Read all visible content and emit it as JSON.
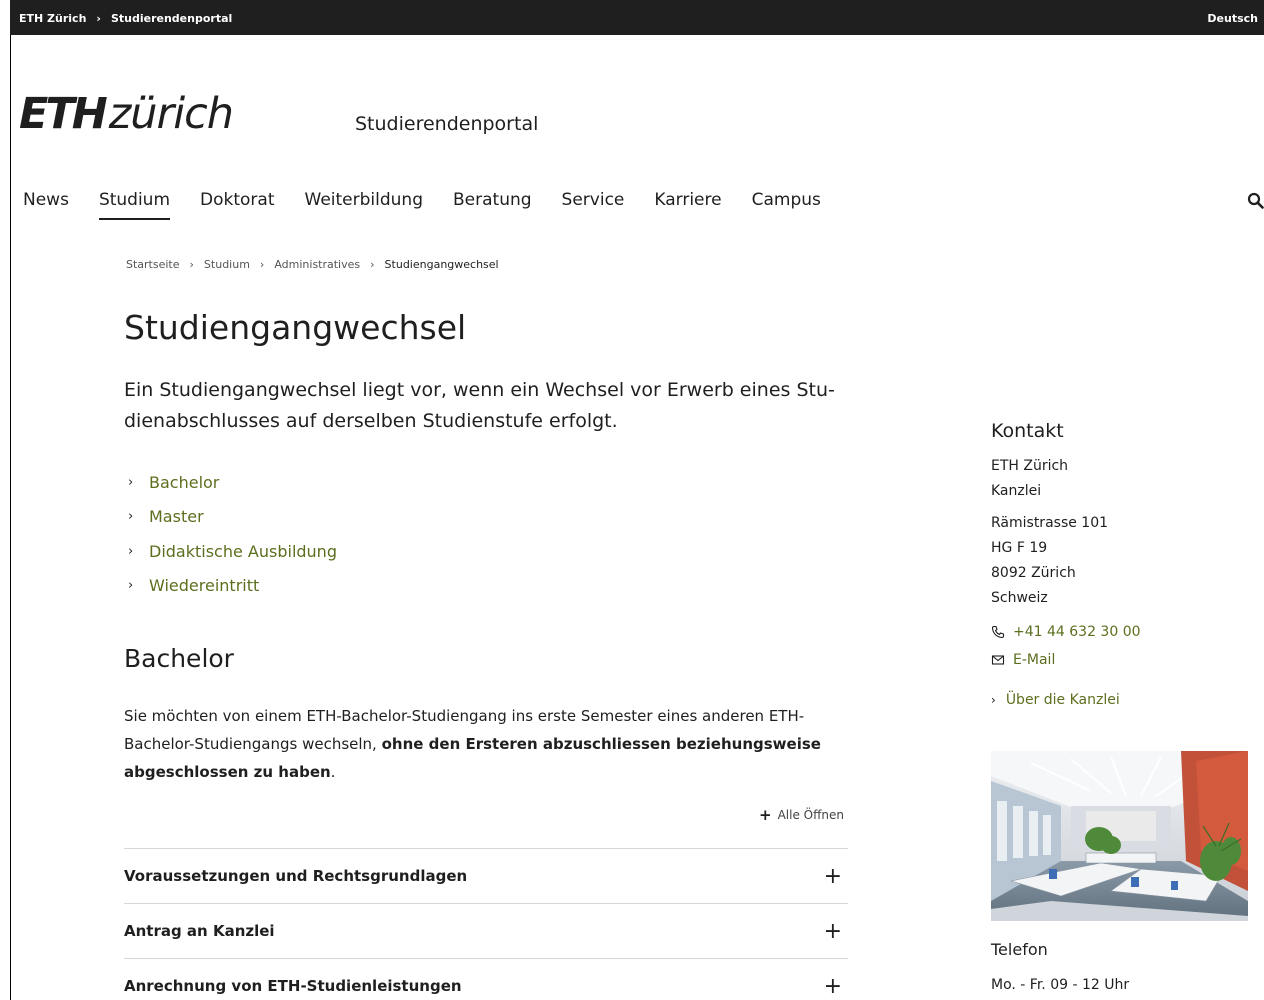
{
  "topbar": {
    "crumbs": [
      "ETH Zürich",
      "Studierendenportal"
    ],
    "sep": "›",
    "language": "Deutsch"
  },
  "logo": {
    "eth": "ETH",
    "zurich": "zürich"
  },
  "portal_title": "Studierendenportal",
  "nav": {
    "items": [
      "News",
      "Studium",
      "Doktorat",
      "Weiterbildung",
      "Beratung",
      "Service",
      "Karriere",
      "Campus"
    ],
    "active": "Studium",
    "search_icon": "search-icon"
  },
  "breadcrumb": {
    "items": [
      "Startseite",
      "Studium",
      "Administratives",
      "Studiengangwechsel"
    ],
    "sep": "›"
  },
  "main": {
    "title": "Studiengangwechsel",
    "lead": "Ein Studiengangwechsel liegt vor, wenn ein Wechsel vor Erwerb eines Stu-dienabschlusses auf derselben Studienstufe erfolgt.",
    "lead_line1": "Ein Studiengangwechsel liegt vor, wenn ein Wechsel vor Erwerb eines Stu-",
    "lead_line2": "dienabschlusses auf derselben Studienstufe erfolgt.",
    "anchors": [
      "Bachelor",
      "Master",
      "Didaktische Ausbildung",
      "Wiedereintritt"
    ],
    "chevron": "›",
    "section_heading": "Bachelor",
    "section_text_1": "Sie möchten von einem ETH-Bachelor-Studiengang ins erste Semester eines anderen ETH-Bachelor-Studiengangs wechseln, ",
    "section_text_bold": "ohne den Ersteren abzuschliessen beziehungsweise abgeschlossen zu haben",
    "section_text_end": ".",
    "open_all": "Alle Öffnen",
    "open_all_symbol": "+",
    "accordion": [
      "Voraussetzungen und Rechtsgrundlagen",
      "Antrag an Kanzlei",
      "Anrechnung von ETH-Studienleistungen"
    ],
    "accordion_symbol": "+"
  },
  "sidebar": {
    "heading": "Kontakt",
    "org_line1": "ETH Zürich",
    "org_line2": "Kanzlei",
    "address": [
      "Rämistrasse 101",
      "HG F 19",
      "8092 Zürich",
      "Schweiz"
    ],
    "phone": "+41 44 632 30 00",
    "email": "E-Mail",
    "about": "Über die Kanzlei",
    "phone_heading": "Telefon",
    "hours": "Mo. - Fr. 09 - 12 Uhr"
  },
  "colors": {
    "link": "#5b6f1e",
    "text": "#1f1f1f",
    "topbar_bg": "#1f1f1f"
  }
}
